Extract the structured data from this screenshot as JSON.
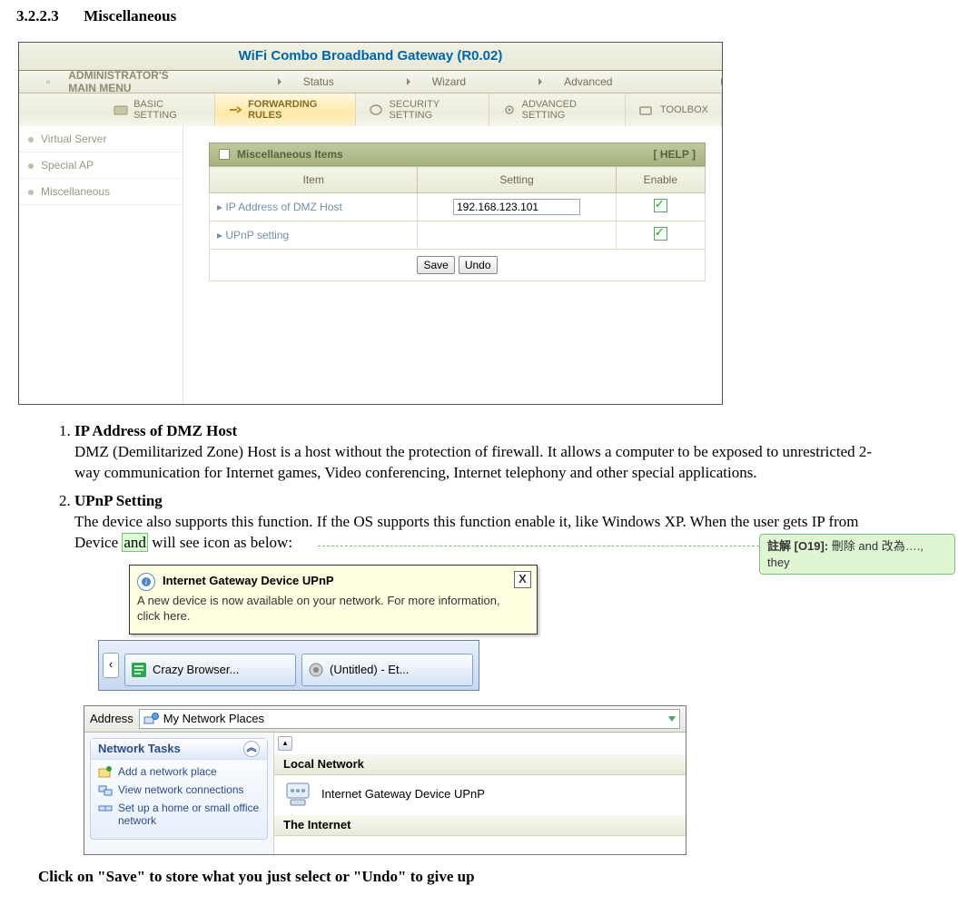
{
  "section": {
    "number": "3.2.2.3",
    "title": "Miscellaneous"
  },
  "router": {
    "title": "WiFi Combo Broadband Gateway (R0.02)",
    "menu": {
      "admin": "ADMINISTRATOR'S MAIN MENU",
      "status": "Status",
      "wizard": "Wizard",
      "advanced": "Advanced",
      "logout": "Logout"
    },
    "tabs": {
      "basic": "BASIC SETTING",
      "forwarding": "FORWARDING RULES",
      "security": "SECURITY SETTING",
      "advanced": "ADVANCED SETTING",
      "toolbox": "TOOLBOX"
    },
    "side": {
      "vserver": "Virtual Server",
      "special": "Special AP",
      "misc": "Miscellaneous"
    },
    "panel": {
      "title": "Miscellaneous Items",
      "help": "[ HELP ]",
      "item_h": "Item",
      "setting_h": "Setting",
      "enable_h": "Enable",
      "row1_item": "IP Address of DMZ Host",
      "row1_value": "192.168.123.101",
      "row2_item": "UPnP setting",
      "save": "Save",
      "undo": "Undo"
    }
  },
  "list": {
    "n1": "1.",
    "t1": "IP Address of DMZ Host",
    "d1": "DMZ (Demilitarized Zone) Host is a host without the protection of firewall. It allows a computer to be exposed to unrestricted 2-way communication for Internet games, Video conferencing, Internet telephony and other special applications.",
    "n2": "2.",
    "t2": "UPnP Setting",
    "d2a": "The device also supports this function. If the OS supports this function enable it, like Windows XP. When the user gets IP from Device ",
    "d2hl": "and",
    "d2b": " will see icon as below:"
  },
  "comment": {
    "label": "註解 [O19]:",
    "text": " 刪除 and 改為…., they"
  },
  "balloon": {
    "title": "Internet Gateway Device UPnP",
    "body": "A new device is now available on your network. For more information, click here.",
    "close": "X"
  },
  "taskbar": {
    "b1": "Crazy Browser...",
    "b2": "(Untitled) - Et..."
  },
  "np": {
    "address_label": "Address",
    "address_value": "My Network Places",
    "tasks_header": "Network Tasks",
    "t1": "Add a network place",
    "t2": "View network connections",
    "t3": "Set up a home or small office network",
    "cat1": "Local Network",
    "item1": "Internet Gateway Device UPnP",
    "cat2": "The Internet"
  },
  "footer": "Click on \"Save\" to store what you just select or \"Undo\" to give up"
}
